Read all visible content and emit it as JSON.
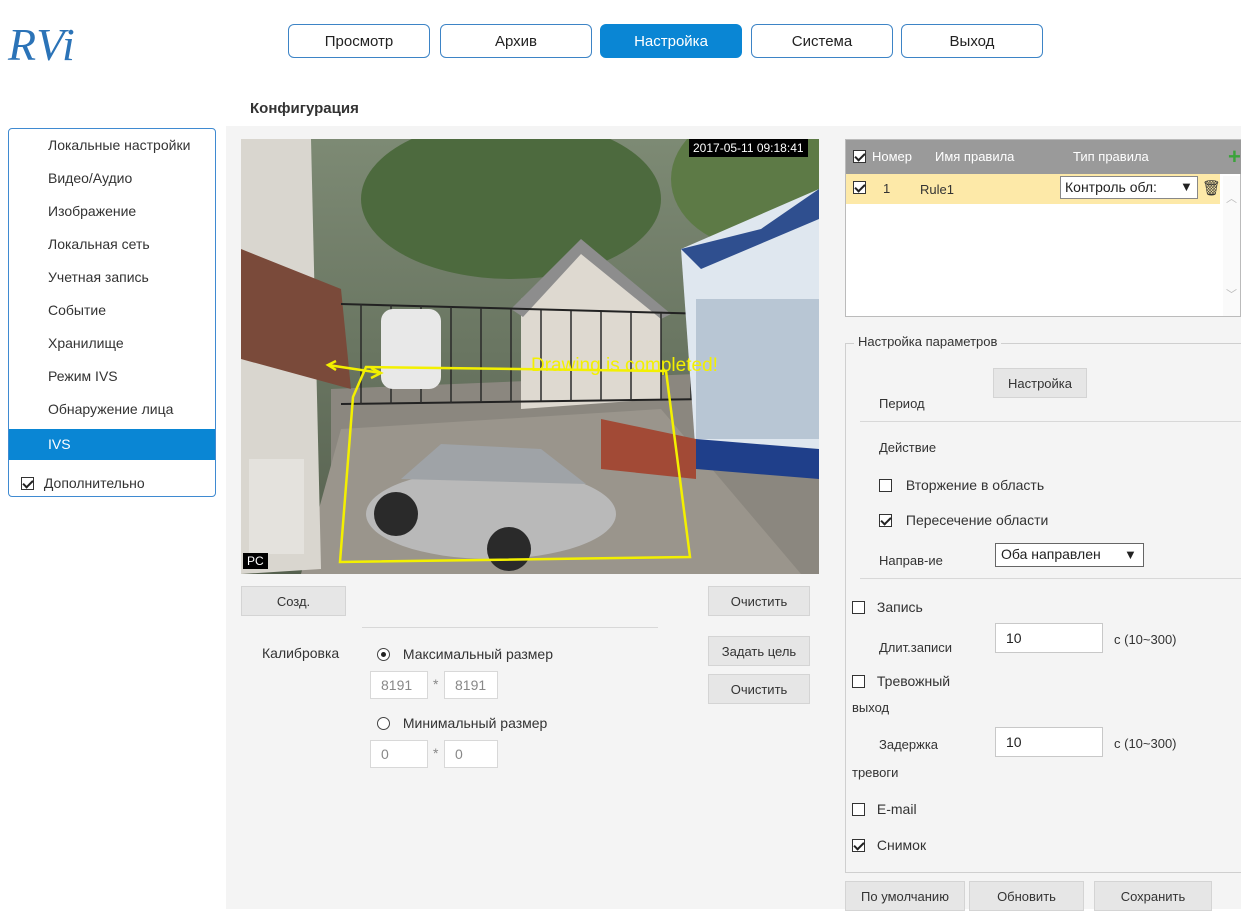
{
  "logo": "RVi",
  "nav": [
    "Просмотр",
    "Архив",
    "Настройка",
    "Система",
    "Выход"
  ],
  "tab": "Конфигурация",
  "sidebar": {
    "items": [
      "Локальные настройки",
      "Видео/Аудио",
      "Изображение",
      "Локальная сеть",
      "Учетная запись",
      "Событие",
      "Хранилище",
      "Режим IVS",
      "Обнаружение лица",
      "IVS"
    ],
    "extra": "Дополнительно"
  },
  "video": {
    "timestamp": "2017-05-11 09:18:41",
    "overlay": "Drawing is completed!",
    "channel": "PC"
  },
  "buttons": {
    "create": "Созд.",
    "clear1": "Очистить",
    "set_target": "Задать цель",
    "clear2": "Очистить",
    "setup": "Настройка",
    "default": "По умолчанию",
    "refresh": "Обновить",
    "save": "Сохранить"
  },
  "calibration": {
    "label": "Калибровка",
    "max_label": "Максимальный размер",
    "max_w": "8191",
    "max_h": "8191",
    "min_label": "Минимальный размер",
    "min_w": "0",
    "min_h": "0",
    "sep": "*"
  },
  "rules": {
    "headers": [
      "Номер",
      "Имя правила",
      "Тип правила"
    ],
    "rows": [
      {
        "num": "1",
        "name": "Rule1",
        "type": "Контроль обл:"
      }
    ]
  },
  "params": {
    "legend": "Настройка параметров",
    "period": "Период",
    "action": "Действие",
    "intrusion": "Вторжение в область",
    "cross": "Пересечение области",
    "direction_label": "Направ-ие",
    "direction_value": "Оба направлен",
    "record": "Запись",
    "rec_duration": "Длит.записи",
    "rec_value": "10",
    "rec_range": "с (10~300)",
    "alarm_out_1": "Тревожный",
    "alarm_out_2": "выход",
    "delay_1": "Задержка",
    "delay_2": "тревоги",
    "delay_value": "10",
    "delay_range": "с (10~300)",
    "email": "E-mail",
    "snapshot": "Снимок"
  },
  "colors": {
    "accent": "#0a86d4",
    "border": "#3f8ad1",
    "highlight_row": "#fde9a8",
    "overlay": "#f3f000"
  }
}
